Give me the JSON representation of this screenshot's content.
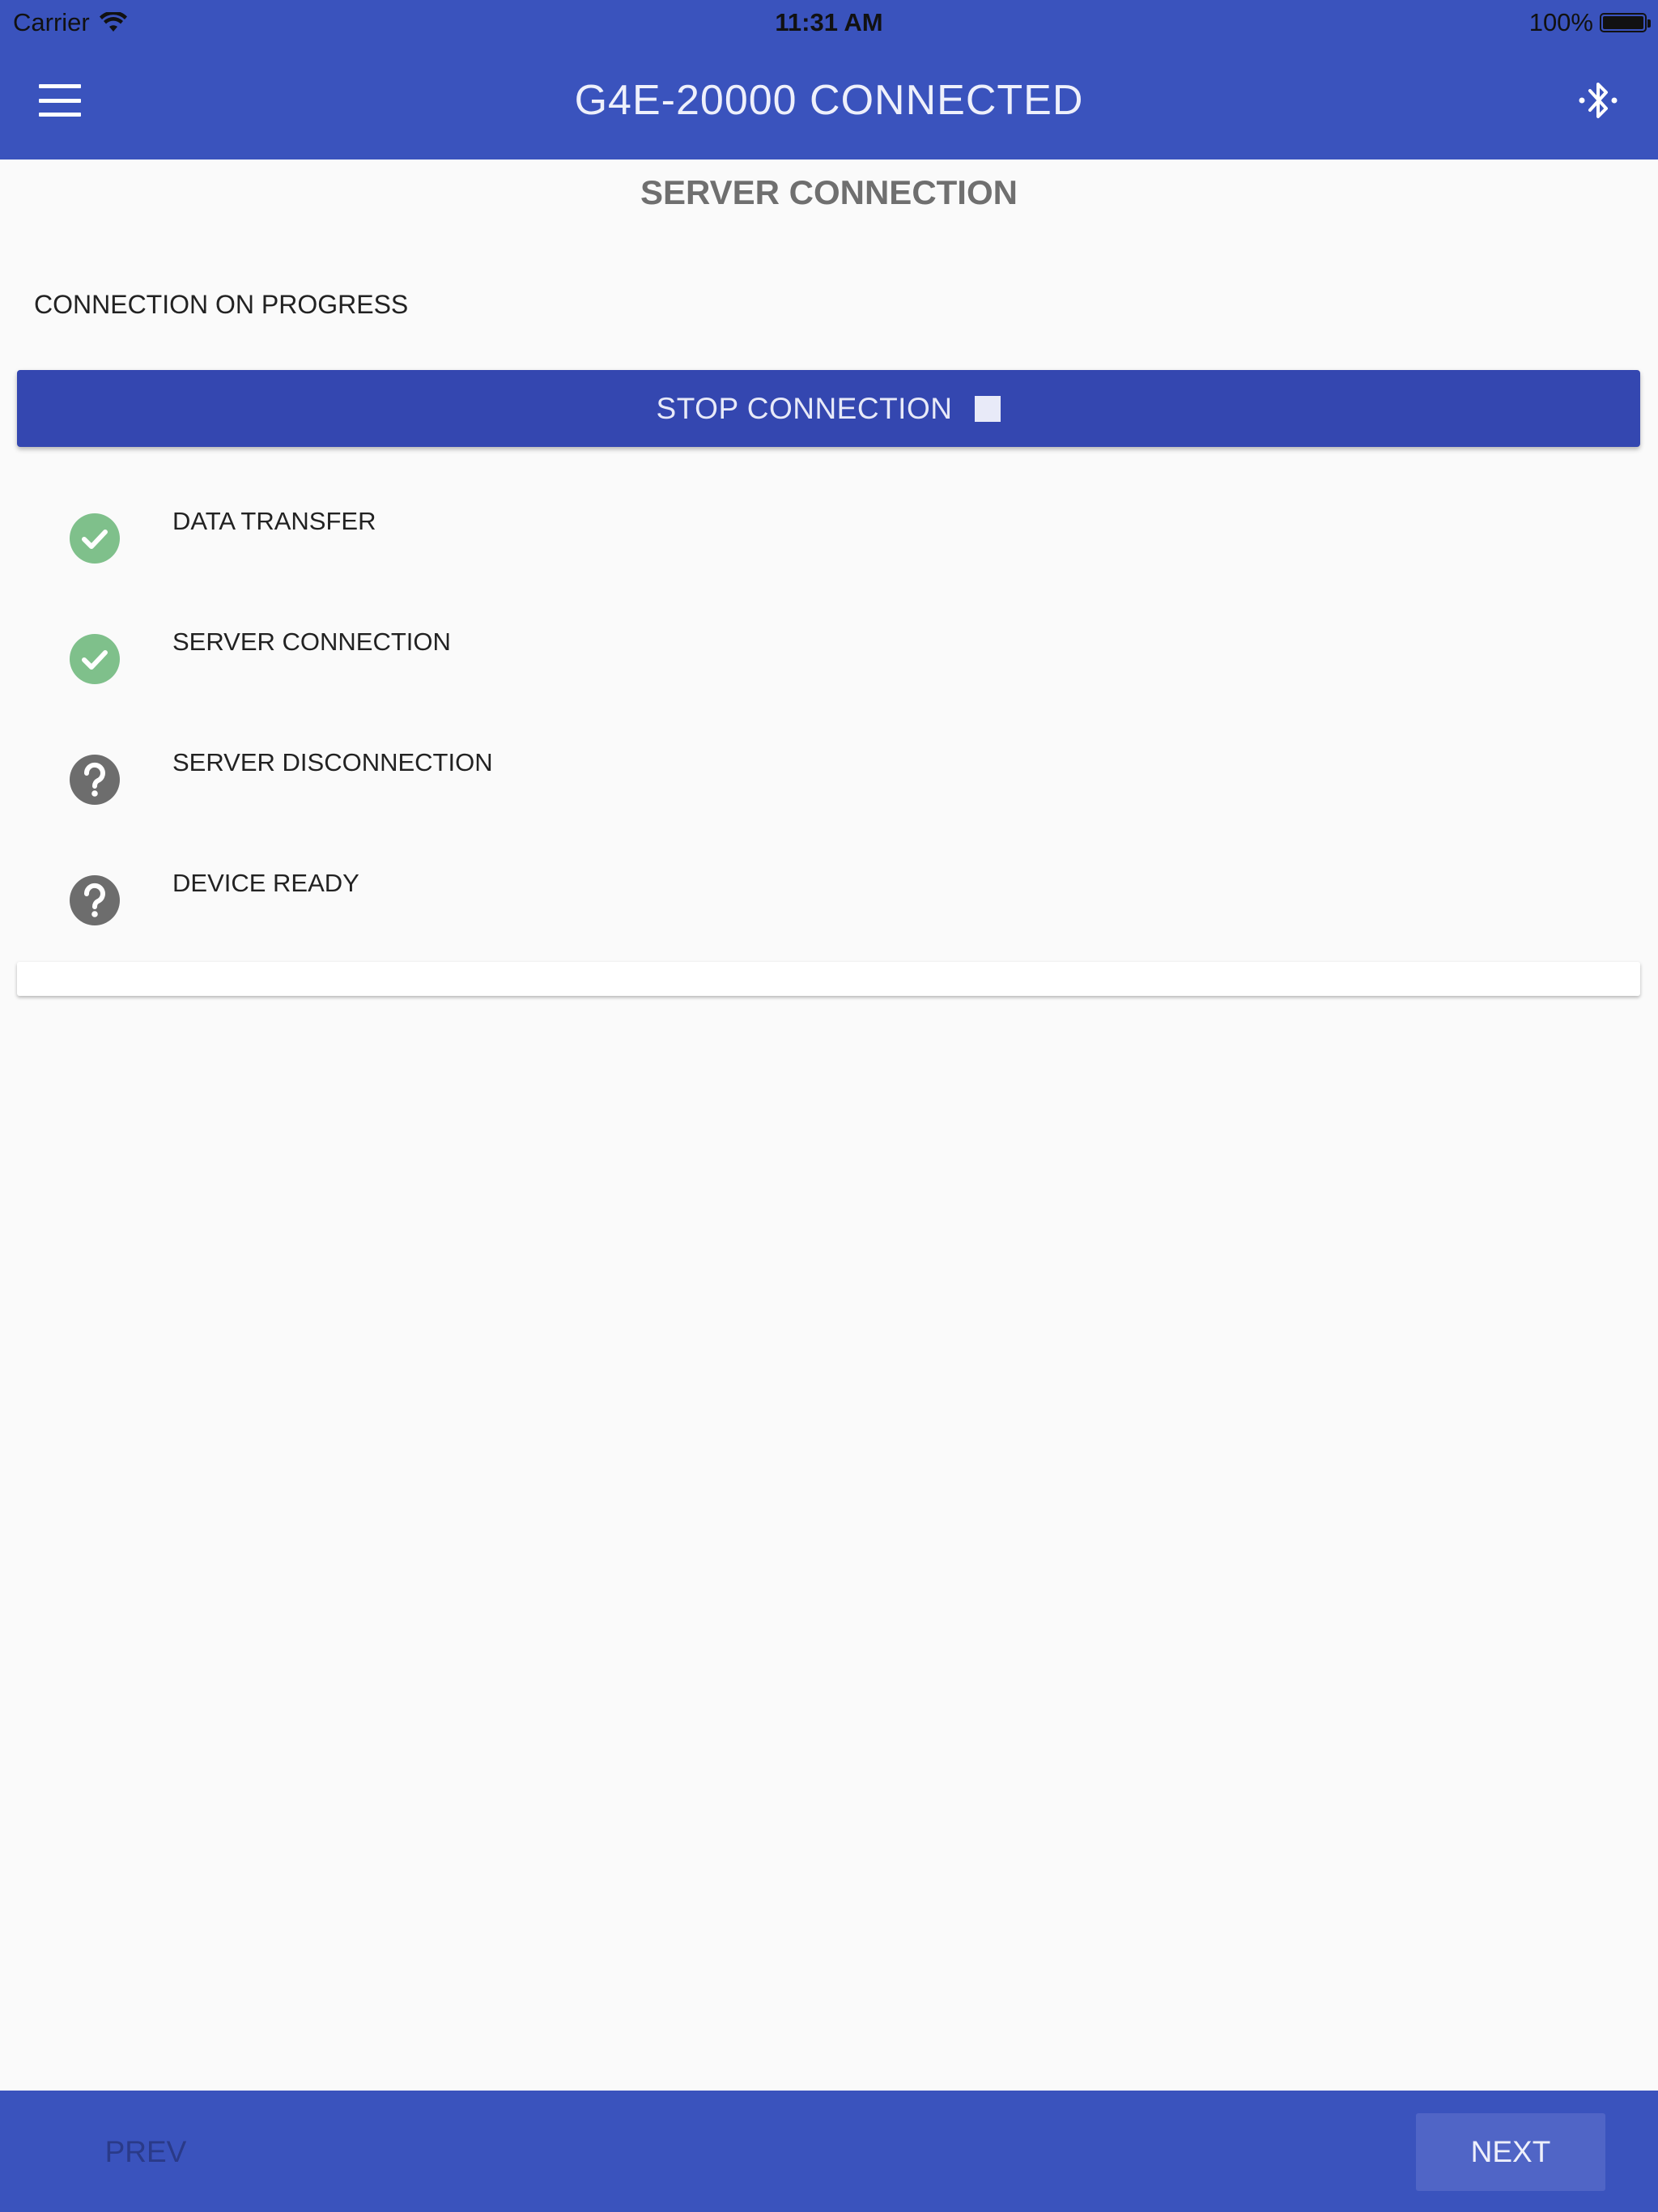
{
  "status_bar": {
    "carrier": "Carrier",
    "time": "11:31 AM",
    "battery": "100%",
    "battery_level": 1.0
  },
  "app_bar": {
    "title": "G4E-20000 CONNECTED",
    "menu_icon": "hamburger-menu-icon",
    "bluetooth_icon": "bluetooth-searching-icon"
  },
  "page": {
    "title": "SERVER CONNECTION",
    "progress_label": "CONNECTION ON PROGRESS",
    "stop_button_label": "STOP CONNECTION",
    "stop_icon": "stop-square-icon"
  },
  "steps": [
    {
      "label": "DATA TRANSFER",
      "status": "done",
      "icon": "check-circle-icon"
    },
    {
      "label": "SERVER CONNECTION",
      "status": "done",
      "icon": "check-circle-icon"
    },
    {
      "label": "SERVER DISCONNECTION",
      "status": "unknown",
      "icon": "help-circle-icon"
    },
    {
      "label": "DEVICE READY",
      "status": "unknown",
      "icon": "help-circle-icon"
    }
  ],
  "footer": {
    "prev_label": "PREV",
    "next_label": "NEXT"
  },
  "colors": {
    "primary": "#3a53bd",
    "button": "#3447b0",
    "done": "#7fc08b",
    "unknown": "#6d6d6d",
    "background": "#fafafa"
  }
}
